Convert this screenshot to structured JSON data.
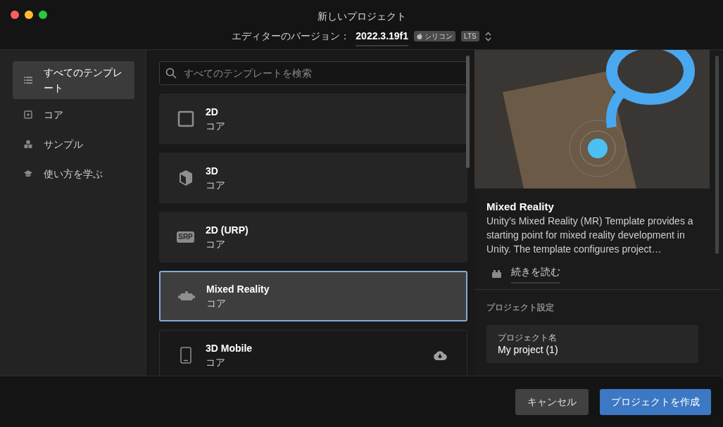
{
  "window": {
    "title": "新しいプロジェクト",
    "version_label": "エディターのバージョン：",
    "version": "2022.3.19f1",
    "badges": [
      "シリコン",
      "LTS"
    ]
  },
  "sidebar": {
    "items": [
      {
        "label": "すべてのテンプレート",
        "kind": "list",
        "selected": true
      },
      {
        "label": "コア",
        "kind": "core",
        "selected": false
      },
      {
        "label": "サンプル",
        "kind": "samples",
        "selected": false
      },
      {
        "label": "使い方を学ぶ",
        "kind": "learn",
        "selected": false
      }
    ]
  },
  "search": {
    "placeholder": "すべてのテンプレートを検索"
  },
  "templates": [
    {
      "name": "2D",
      "category": "コア",
      "kind": "square",
      "selected": false,
      "downloadable": false
    },
    {
      "name": "3D",
      "category": "コア",
      "kind": "cube",
      "selected": false,
      "downloadable": false
    },
    {
      "name": "2D (URP)",
      "category": "コア",
      "kind": "badge",
      "badge": "SRP",
      "selected": false,
      "downloadable": false
    },
    {
      "name": "Mixed Reality",
      "category": "コア",
      "kind": "headset",
      "selected": true,
      "downloadable": false
    },
    {
      "name": "3D Mobile",
      "category": "コア",
      "kind": "phone",
      "selected": false,
      "downloadable": true
    }
  ],
  "details": {
    "title": "Mixed Reality",
    "description": "Unity’s Mixed Reality (MR) Template provides a starting point for mixed reality development in Unity. The template configures project…",
    "read_more": "続きを読む",
    "settings_heading": "プロジェクト設定",
    "fields": [
      {
        "label": "プロジェクト名",
        "value": "My project (1)"
      }
    ]
  },
  "buttons": {
    "cancel": "キャンセル",
    "create": "プロジェクトを作成"
  }
}
